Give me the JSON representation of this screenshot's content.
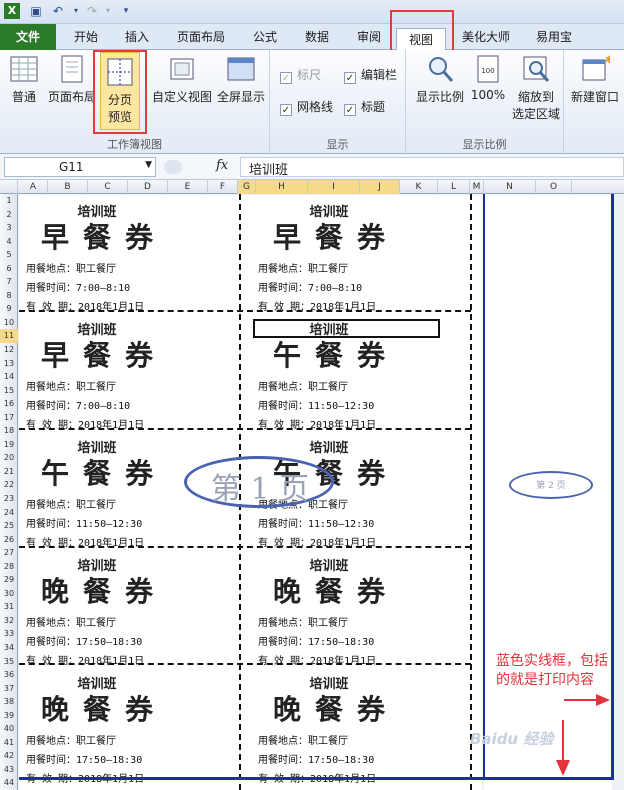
{
  "window": {
    "title": "Excel"
  },
  "tabs": {
    "file": "文件",
    "home": "开始",
    "insert": "插入",
    "layout": "页面布局",
    "formula": "公式",
    "data": "数据",
    "review": "审阅",
    "view": "视图",
    "beautify": "美化大师",
    "tools": "易用宝"
  },
  "ribbon": {
    "views": {
      "normal": "普通",
      "page_layout": "页面布局",
      "page_break_line1": "分页",
      "page_break_line2": "预览",
      "custom": "自定义视图",
      "fullscreen": "全屏显示",
      "group_label": "工作簿视图"
    },
    "show": {
      "ruler": "标尺",
      "formula_bar": "编辑栏",
      "gridlines": "网格线",
      "headings": "标题",
      "group_label": "显示"
    },
    "zoom": {
      "zoom": "显示比例",
      "hundred": "100%",
      "fit_line1": "缩放到",
      "fit_line2": "选定区域",
      "group_label": "显示比例"
    },
    "window": {
      "new_window": "新建窗口"
    }
  },
  "formula_bar": {
    "name_box": "G11",
    "fx": "fx",
    "content": "培训班"
  },
  "columns": [
    "A",
    "B",
    "C",
    "D",
    "E",
    "F",
    "G",
    "H",
    "I",
    "J",
    "K",
    "L",
    "M",
    "N",
    "O"
  ],
  "rows": [
    "1",
    "2",
    "3",
    "4",
    "5",
    "6",
    "7",
    "8",
    "9",
    "10",
    "11",
    "12",
    "13",
    "14",
    "15",
    "16",
    "17",
    "18",
    "19",
    "20",
    "21",
    "22",
    "23",
    "24",
    "25",
    "26",
    "27",
    "28",
    "29",
    "30",
    "31",
    "32",
    "33",
    "34",
    "35",
    "36",
    "37",
    "38",
    "39",
    "40",
    "41",
    "42",
    "43",
    "44"
  ],
  "cards": [
    {
      "title": "培训班",
      "big": "早餐券",
      "loc": "用餐地点：职工餐厅",
      "time": "用餐时间：7:00—8:10",
      "valid": "有 效 期：2018年1月1日"
    },
    {
      "title": "培训班",
      "big": "早餐券",
      "loc": "用餐地点：职工餐厅",
      "time": "用餐时间：7:00—8:10",
      "valid": "有 效 期：2018年1月1日"
    },
    {
      "title": "培训班",
      "big": "早餐券",
      "loc": "用餐地点：职工餐厅",
      "time": "用餐时间：7:00—8:10",
      "valid": "有 效 期：2018年1月1日"
    },
    {
      "title": "培训班",
      "big": "午餐券",
      "loc": "用餐地点：职工餐厅",
      "time": "用餐时间：11:50—12:30",
      "valid": "有 效 期：2018年1月1日"
    },
    {
      "title": "培训班",
      "big": "午餐券",
      "loc": "用餐地点：职工餐厅",
      "time": "用餐时间：11:50—12:30",
      "valid": "有 效 期：2018年1月1日"
    },
    {
      "title": "培训班",
      "big": "午餐券",
      "loc": "用餐地点：职工餐厅",
      "time": "用餐时间：11:50—12:30",
      "valid": "有 效 期：2018年1月1日"
    },
    {
      "title": "培训班",
      "big": "晚餐券",
      "loc": "用餐地点：职工餐厅",
      "time": "用餐时间：17:50—18:30",
      "valid": "有 效 期：2018年1月1日"
    },
    {
      "title": "培训班",
      "big": "晚餐券",
      "loc": "用餐地点：职工餐厅",
      "time": "用餐时间：17:50—18:30",
      "valid": "有 效 期：2018年1月1日"
    },
    {
      "title": "培训班",
      "big": "晚餐券",
      "loc": "用餐地点：职工餐厅",
      "time": "用餐时间：17:50—18:30",
      "valid": "有 效 期：2018年1月1日"
    },
    {
      "title": "培训班",
      "big": "晚餐券",
      "loc": "用餐地点：职工餐厅",
      "time": "用餐时间：17:50—18:30",
      "valid": "有 效 期：2018年1月1日"
    }
  ],
  "watermarks": {
    "page1": "第 1 页",
    "page2": "第 2 页"
  },
  "annotation": {
    "text": "蓝色实线框，包括的就是打印内容"
  },
  "watermark_logo": "Baidu 经验",
  "colors": {
    "file_tab": "#2a7a2a",
    "highlight": "#e03c3c",
    "print_area": "#1a2fa0",
    "annotation": "#e2323a",
    "selected_button": "#fde7a0"
  }
}
